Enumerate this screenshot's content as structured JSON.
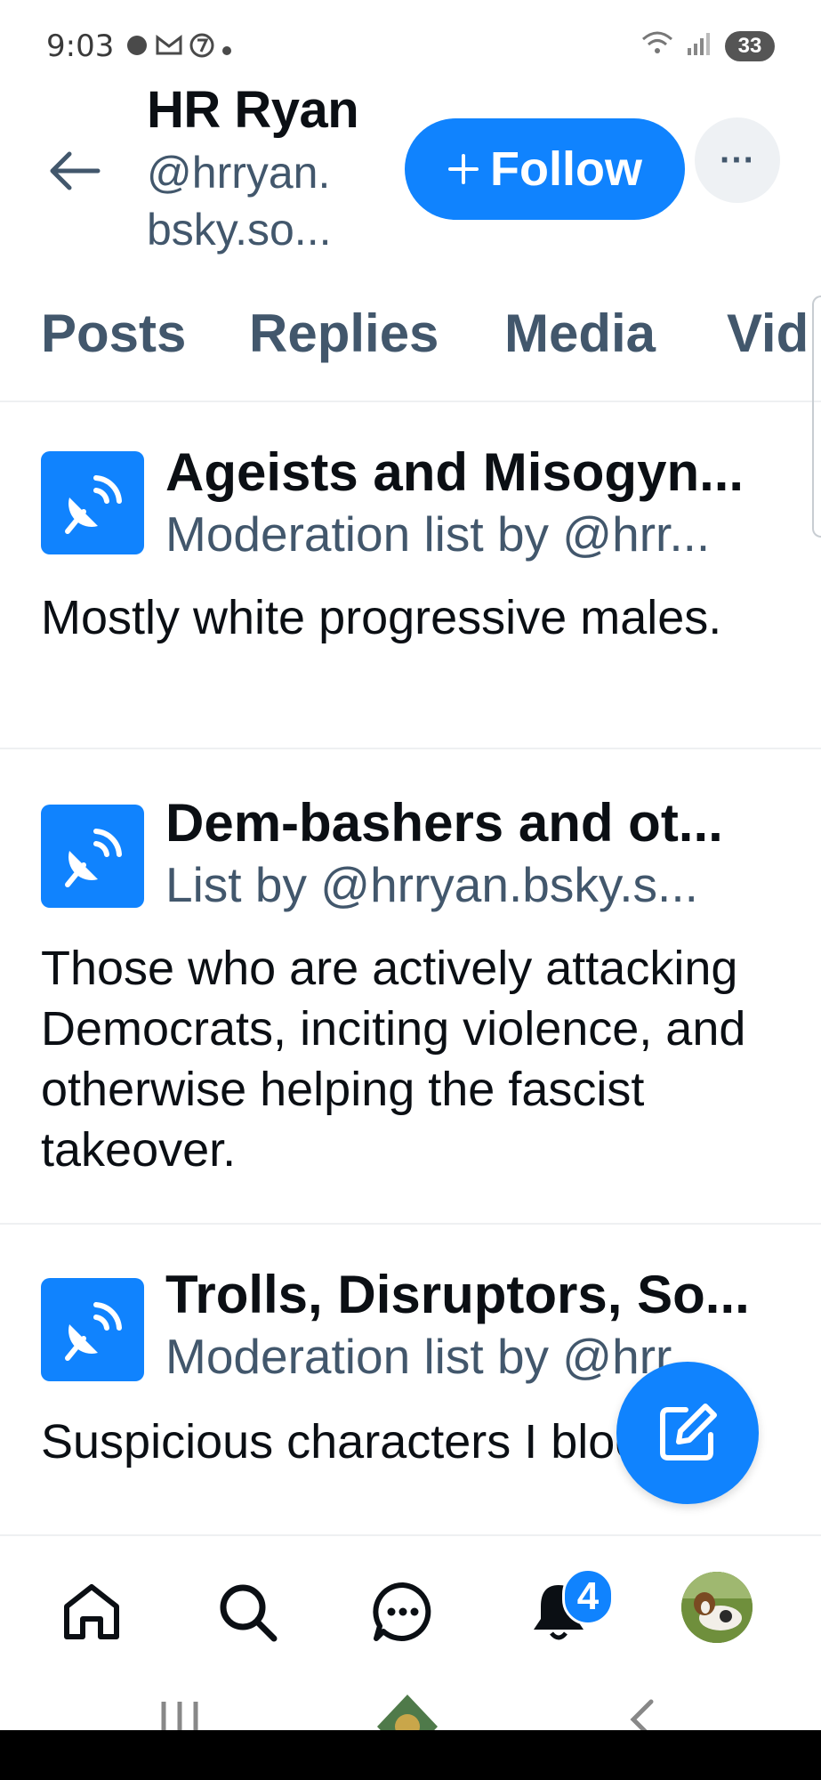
{
  "status_bar": {
    "time": "9:03",
    "left_icons": [
      "signal-app-icon",
      "gmail-icon",
      "channel7-icon",
      "dot-icon"
    ],
    "battery": "33"
  },
  "header": {
    "name": "HR Ryan",
    "handle": "@hrryan.\nbsky.so...",
    "follow_label": "Follow",
    "more_label": "···"
  },
  "tabs": [
    {
      "label": "Posts"
    },
    {
      "label": "Replies"
    },
    {
      "label": "Media"
    },
    {
      "label": "Vid"
    }
  ],
  "lists": [
    {
      "title": "Ageists and Misogyn...",
      "subtitle": "Moderation list by @hrr...",
      "description": "Mostly white progressive males."
    },
    {
      "title": "Dem-bashers and ot...",
      "subtitle": "List by @hrryan.bsky.s...",
      "description": "Those who are actively attacking Democrats, inciting violence, and otherwise helping the fascist takeover."
    },
    {
      "title": "Trolls, Disruptors, So...",
      "subtitle": "Moderation list by @hrr...",
      "description": "Suspicious characters I blocked."
    }
  ],
  "bottom_nav": {
    "items": [
      "home-icon",
      "search-icon",
      "chat-icon",
      "bell-icon",
      "profile-avatar"
    ],
    "notification_count": "4"
  },
  "colors": {
    "accent": "#1083fe",
    "muted_text": "#42576c",
    "text": "#0b0f14"
  }
}
